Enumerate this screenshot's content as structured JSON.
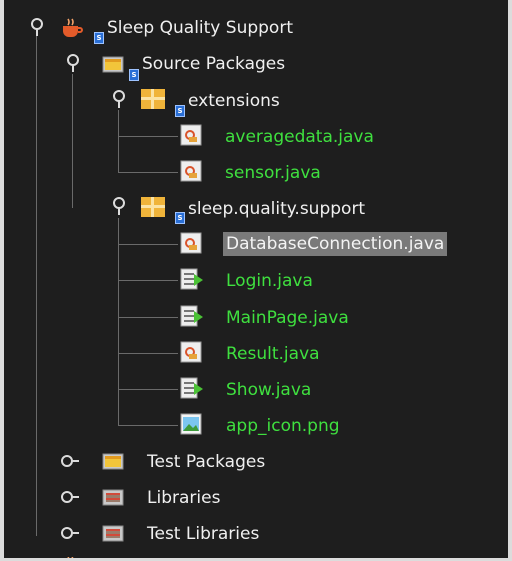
{
  "project": {
    "label": "Sleep Quality Support",
    "icon": "coffee-cup-project-icon",
    "expanded": true
  },
  "source_packages": {
    "label": "Source Packages",
    "icon": "source-folder-icon",
    "expanded": true,
    "packages": [
      {
        "label": "extensions",
        "icon": "package-icon",
        "expanded": true,
        "files": [
          {
            "label": "averagedata.java",
            "icon": "java-class-icon",
            "color": "#3fe03f"
          },
          {
            "label": "sensor.java",
            "icon": "java-class-icon",
            "color": "#3fe03f"
          }
        ]
      },
      {
        "label": "sleep.quality.support",
        "icon": "package-icon",
        "expanded": true,
        "files": [
          {
            "label": "DatabaseConnection.java",
            "icon": "java-class-icon",
            "selected": true
          },
          {
            "label": "Login.java",
            "icon": "java-form-icon",
            "color": "#3fe03f"
          },
          {
            "label": "MainPage.java",
            "icon": "java-form-icon",
            "color": "#3fe03f"
          },
          {
            "label": "Result.java",
            "icon": "java-class-icon",
            "color": "#3fe03f"
          },
          {
            "label": "Show.java",
            "icon": "java-form-icon",
            "color": "#3fe03f"
          },
          {
            "label": "app_icon.png",
            "icon": "image-file-icon",
            "color": "#3fe03f"
          }
        ]
      }
    ]
  },
  "other_nodes": [
    {
      "label": "Test Packages",
      "icon": "test-folder-icon",
      "expanded": false
    },
    {
      "label": "Libraries",
      "icon": "library-folder-icon",
      "expanded": false
    },
    {
      "label": "Test Libraries",
      "icon": "library-folder-icon",
      "expanded": false
    }
  ],
  "colors": {
    "background": "#1e1e1e",
    "text": "#f0f0f0",
    "modified_file": "#3fe03f",
    "selection": "#7a7a7a"
  }
}
